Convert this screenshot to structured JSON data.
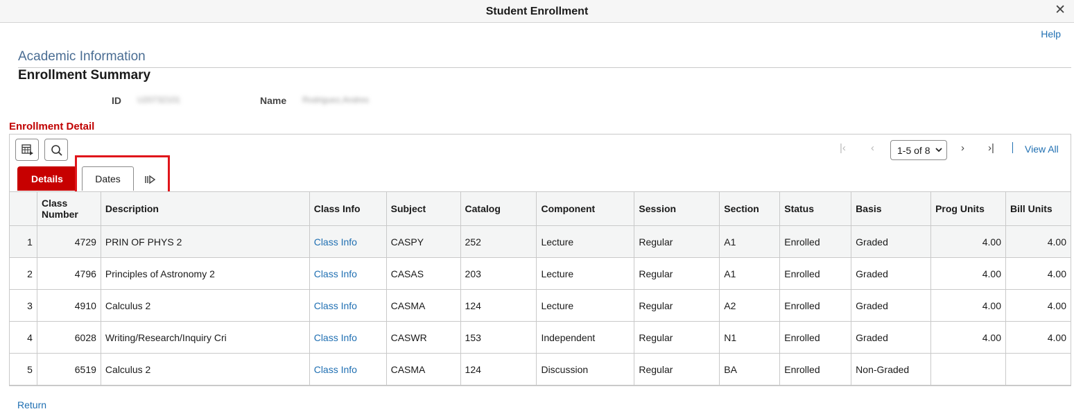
{
  "window": {
    "title": "Student Enrollment",
    "close_glyph": "✕"
  },
  "header": {
    "help_label": "Help",
    "section_title": "Academic Information",
    "page_title": "Enrollment Summary"
  },
  "identity": {
    "id_label": "ID",
    "id_value": "U20732101",
    "name_label": "Name",
    "name_value": "Rodriguez,Andres"
  },
  "grid": {
    "heading": "Enrollment Detail",
    "toolbar": {
      "personalize_icon": "grid-personalize-icon",
      "find_icon": "search-icon"
    },
    "pager": {
      "first_glyph": "|‹",
      "prev_glyph": "‹",
      "range": "1-5 of 8",
      "next_glyph": "›",
      "last_glyph": "›|",
      "view_all_label": "View All"
    },
    "tabs": [
      {
        "label": "Details",
        "active": true
      },
      {
        "label": "Dates",
        "active": false
      }
    ],
    "show_all_columns_icon": "show-all-columns-icon",
    "columns": [
      "",
      "Class Number",
      "Description",
      "Class Info",
      "Subject",
      "Catalog",
      "Component",
      "Session",
      "Section",
      "Status",
      "Basis",
      "Prog Units",
      "Bill Units"
    ],
    "rows": [
      {
        "n": "1",
        "class_number": "4729",
        "description": "PRIN OF PHYS 2",
        "class_info": "Class Info",
        "subject": "CASPY",
        "catalog": "252",
        "component": "Lecture",
        "session": "Regular",
        "section": "A1",
        "status": "Enrolled",
        "basis": "Graded",
        "prog_units": "4.00",
        "bill_units": "4.00"
      },
      {
        "n": "2",
        "class_number": "4796",
        "description": "Principles of Astronomy 2",
        "class_info": "Class Info",
        "subject": "CASAS",
        "catalog": "203",
        "component": "Lecture",
        "session": "Regular",
        "section": "A1",
        "status": "Enrolled",
        "basis": "Graded",
        "prog_units": "4.00",
        "bill_units": "4.00"
      },
      {
        "n": "3",
        "class_number": "4910",
        "description": "Calculus 2",
        "class_info": "Class Info",
        "subject": "CASMA",
        "catalog": "124",
        "component": "Lecture",
        "session": "Regular",
        "section": "A2",
        "status": "Enrolled",
        "basis": "Graded",
        "prog_units": "4.00",
        "bill_units": "4.00"
      },
      {
        "n": "4",
        "class_number": "6028",
        "description": "Writing/Research/Inquiry Cri",
        "class_info": "Class Info",
        "subject": "CASWR",
        "catalog": "153",
        "component": "Independent",
        "session": "Regular",
        "section": "N1",
        "status": "Enrolled",
        "basis": "Graded",
        "prog_units": "4.00",
        "bill_units": "4.00"
      },
      {
        "n": "5",
        "class_number": "6519",
        "description": "Calculus 2",
        "class_info": "Class Info",
        "subject": "CASMA",
        "catalog": "124",
        "component": "Discussion",
        "session": "Regular",
        "section": "BA",
        "status": "Enrolled",
        "basis": "Non-Graded",
        "prog_units": "",
        "bill_units": ""
      }
    ]
  },
  "footer": {
    "return_label": "Return"
  },
  "colors": {
    "accent_red": "#c70000",
    "link_blue": "#1f6fb2",
    "heading_blue": "#4a6d93",
    "highlight_red": "#e0161b"
  }
}
